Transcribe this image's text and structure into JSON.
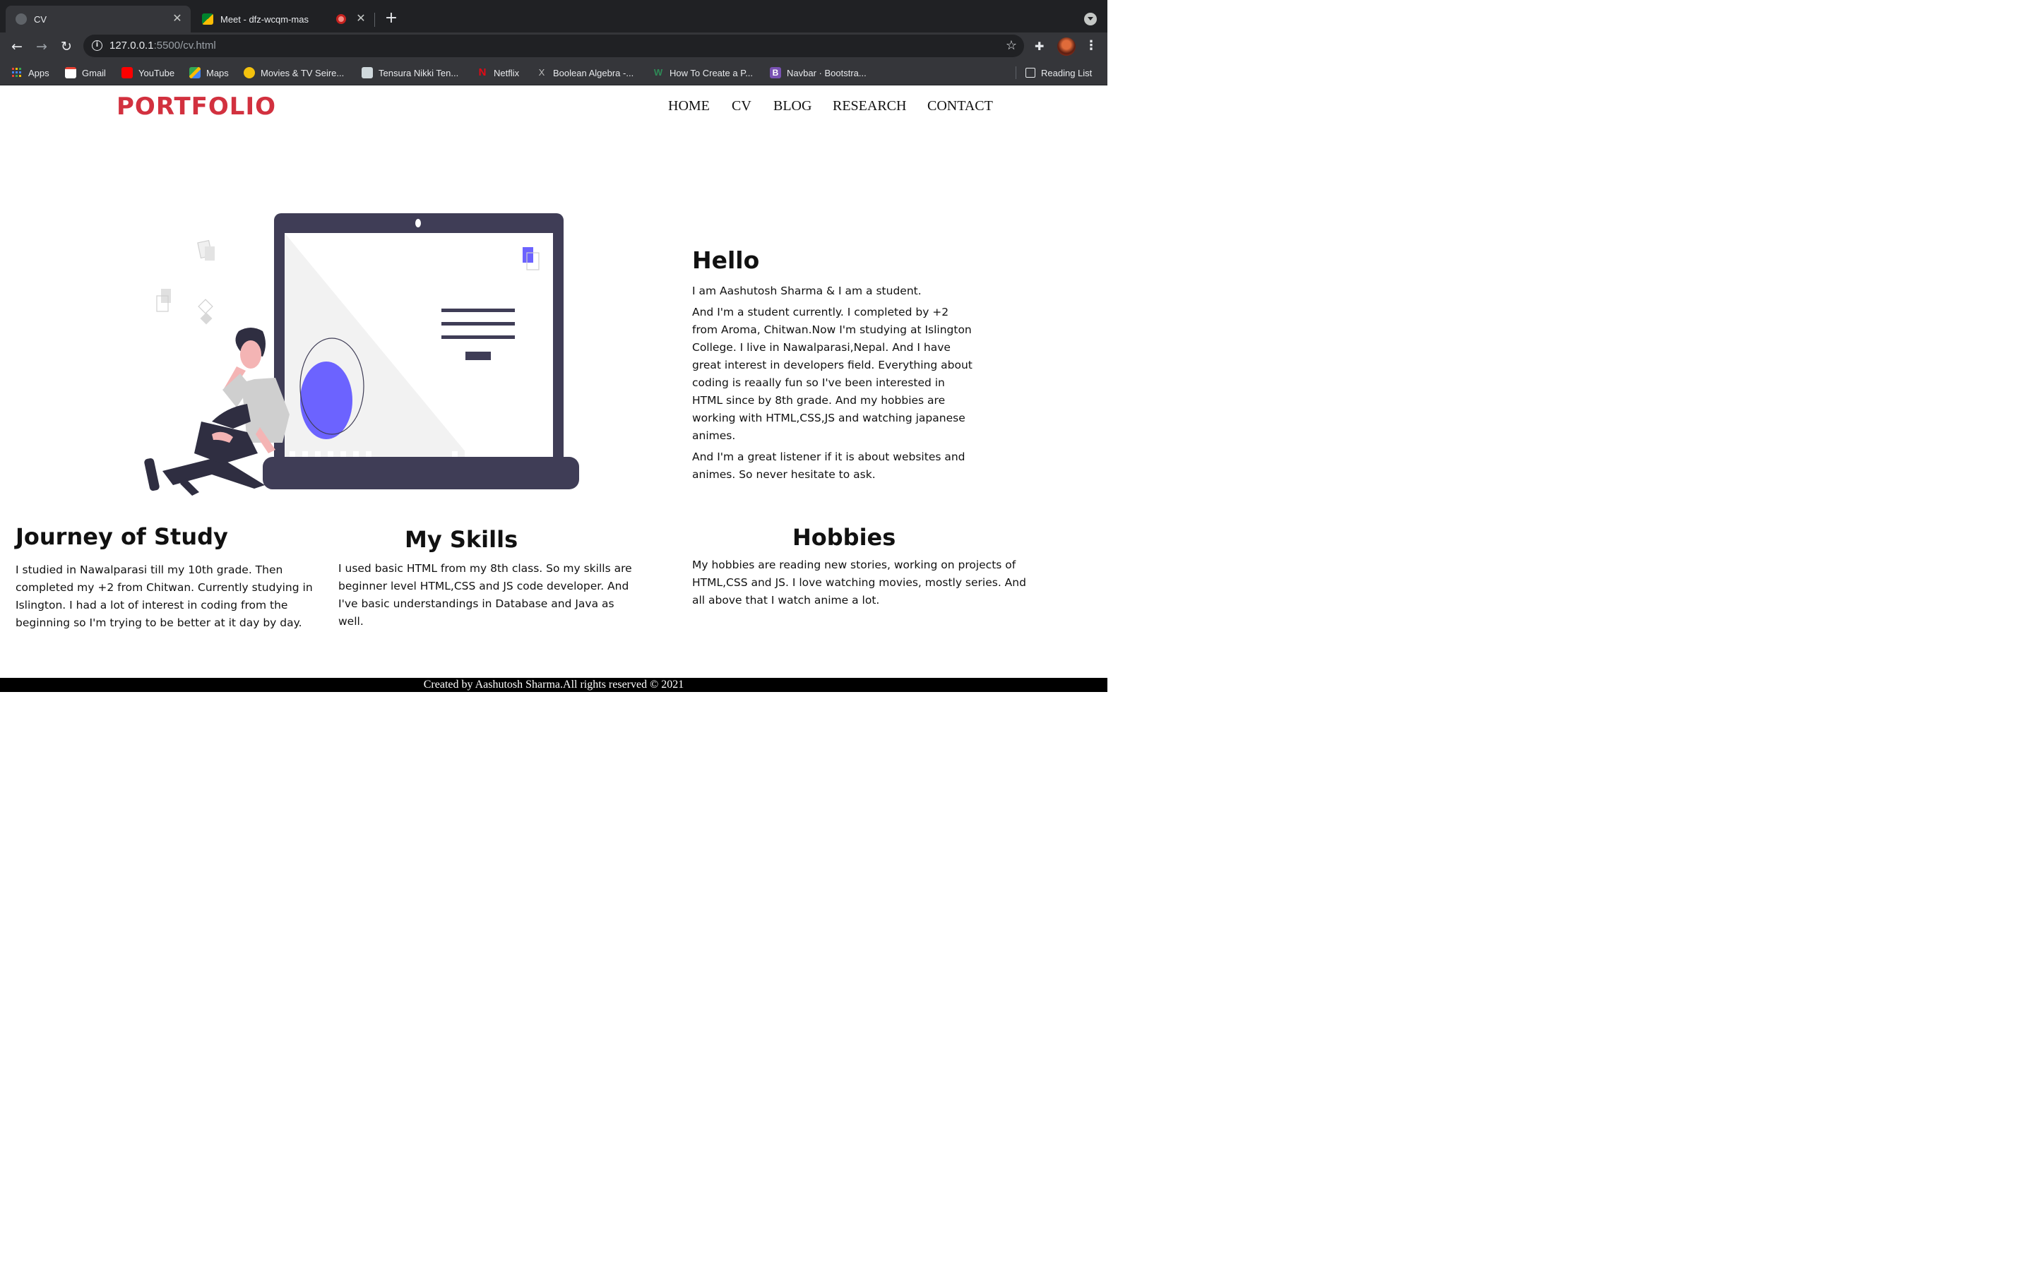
{
  "browser": {
    "tabs": [
      {
        "title": "CV",
        "active": true
      },
      {
        "title": "Meet - dfz-wcqm-mas",
        "active": false
      }
    ],
    "address": {
      "host": "127.0.0.1",
      "rest": ":5500/cv.html"
    },
    "bookmarks": [
      {
        "label": "Apps",
        "icon": "apps-grid-icon",
        "color": "#4285f4"
      },
      {
        "label": "Gmail",
        "icon": "gmail-icon",
        "color": "#ea4335"
      },
      {
        "label": "YouTube",
        "icon": "youtube-icon",
        "color": "#ff0000"
      },
      {
        "label": "Maps",
        "icon": "maps-icon",
        "color": "#34a853"
      },
      {
        "label": "Movies & TV Seire...",
        "icon": "movies-icon",
        "color": "#f4c20d"
      },
      {
        "label": "Tensura Nikki Ten...",
        "icon": "manga-icon",
        "color": "#9ab"
      },
      {
        "label": "Netflix",
        "icon": "netflix-icon",
        "color": "#e50914"
      },
      {
        "label": "Boolean Algebra -...",
        "icon": "boolean-icon",
        "color": "#222"
      },
      {
        "label": "How To Create a P...",
        "icon": "w-icon",
        "color": "#2e8b57"
      },
      {
        "label": "Navbar · Bootstra...",
        "icon": "bootstrap-icon",
        "color": "#7952b3"
      }
    ],
    "reading_list": "Reading List"
  },
  "site": {
    "logo": "PORTFOLIO",
    "nav": [
      "HOME",
      "CV",
      "BLOG",
      "RESEARCH",
      "CONTACT"
    ],
    "accent": "#d2313f",
    "illustration_accent": "#6c63ff"
  },
  "about": {
    "heading": "Hello",
    "intro": "I am Aashutosh Sharma & I am a student.",
    "para1": "And I'm a student currently. I completed by +2 from Aroma, Chitwan.Now I'm studying at Islington College. I live in Nawalparasi,Nepal. And I have great interest in developers field. Everything about coding is reaally fun so I've been interested in HTML since by 8th grade. And my hobbies are working with HTML,CSS,JS and watching japanese animes.",
    "para2": "And I'm a great listener if it is about websites and animes. So never hesitate to ask."
  },
  "sections": {
    "journey": {
      "heading": "Journey of Study",
      "text": "I studied in Nawalparasi till my 10th grade. Then completed my +2 from Chitwan. Currently studying in Islington. I had a lot of interest in coding from the beginning so I'm trying to be better at it day by day."
    },
    "skills": {
      "heading": "My Skills",
      "text": "I used basic HTML from my 8th class. So my skills are beginner level HTML,CSS and JS code developer. And I've basic understandings in Database and Java as well."
    },
    "hobbies": {
      "heading": "Hobbies",
      "text": "My hobbies are reading new stories, working on projects of HTML,CSS and JS. I love watching movies, mostly series. And all above that I watch anime a lot."
    }
  },
  "footer": "Created by Aashutosh Sharma.All rights reserved © 2021"
}
